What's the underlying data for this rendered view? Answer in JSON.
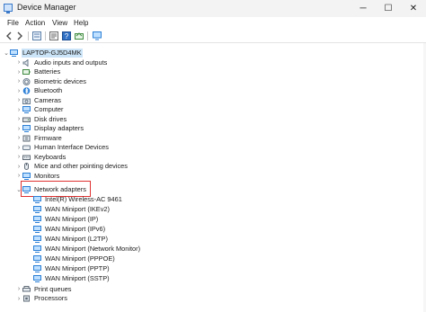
{
  "window": {
    "title": "Device Manager",
    "controls": {
      "minimize": "─",
      "maximize": "☐",
      "close": "✕"
    }
  },
  "menu": [
    "File",
    "Action",
    "View",
    "Help"
  ],
  "toolbar": {
    "icons": [
      "back-icon",
      "forward-icon",
      "show-hide-tree-icon",
      "properties-icon",
      "help-icon",
      "scan-hardware-icon",
      "monitor-icon"
    ]
  },
  "tree": {
    "root": "LAPTOP-GJ5D4MK",
    "categories": [
      "Audio inputs and outputs",
      "Batteries",
      "Biometric devices",
      "Bluetooth",
      "Cameras",
      "Computer",
      "Disk drives",
      "Display adapters",
      "Firmware",
      "Human Interface Devices",
      "Keyboards",
      "Mice and other pointing devices",
      "Monitors",
      "Network adapters"
    ],
    "network_adapters": [
      "Intel(R) Wireless-AC 9461",
      "WAN Miniport (IKEv2)",
      "WAN Miniport (IP)",
      "WAN Miniport (IPv6)",
      "WAN Miniport (L2TP)",
      "WAN Miniport (Network Monitor)",
      "WAN Miniport (PPPOE)",
      "WAN Miniport (PPTP)",
      "WAN Miniport (SSTP)"
    ],
    "after": [
      "Print queues",
      "Processors"
    ]
  },
  "colors": {
    "highlight_box": "#e03131",
    "selection": "#cce4f7",
    "network_icon": "#2b7fd6"
  }
}
